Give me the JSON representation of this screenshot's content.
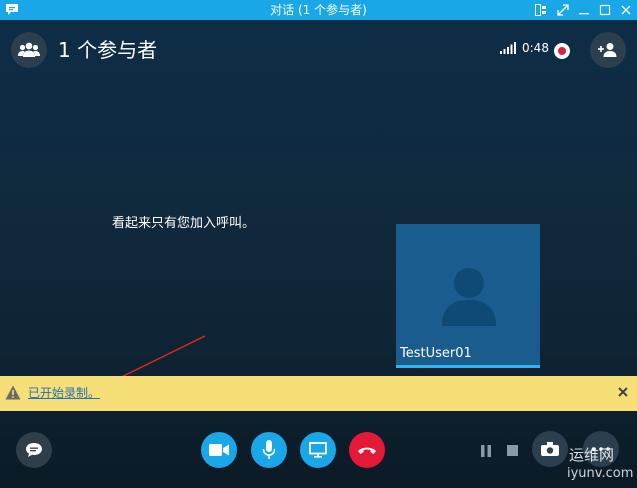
{
  "window": {
    "title": "对话 (1 个参与者)",
    "titlebar_color": "#1aa7e8"
  },
  "header": {
    "participants_count": "1 个参与者",
    "call_timer": "0:48"
  },
  "stage": {
    "alone_message": "看起来只有您加入呼叫。",
    "self_name": "TestUser01"
  },
  "notice": {
    "message": "已开始录制。",
    "background": "#f6df76"
  },
  "watermark": {
    "line1": "运维网",
    "line2": "iyunv.com"
  },
  "icons": {
    "app": "chat-bubble-icon",
    "participants": "people-icon",
    "signal": "signal-bars-icon",
    "recording": "record-icon",
    "add_person": "add-person-icon",
    "warning": "warning-icon",
    "close": "close-icon",
    "chat": "chat-icon",
    "video": "video-camera-icon",
    "mic": "microphone-icon",
    "share": "screen-share-icon",
    "end_call": "hang-up-icon",
    "pause": "pause-icon",
    "stop": "stop-icon",
    "more": "more-icon"
  }
}
